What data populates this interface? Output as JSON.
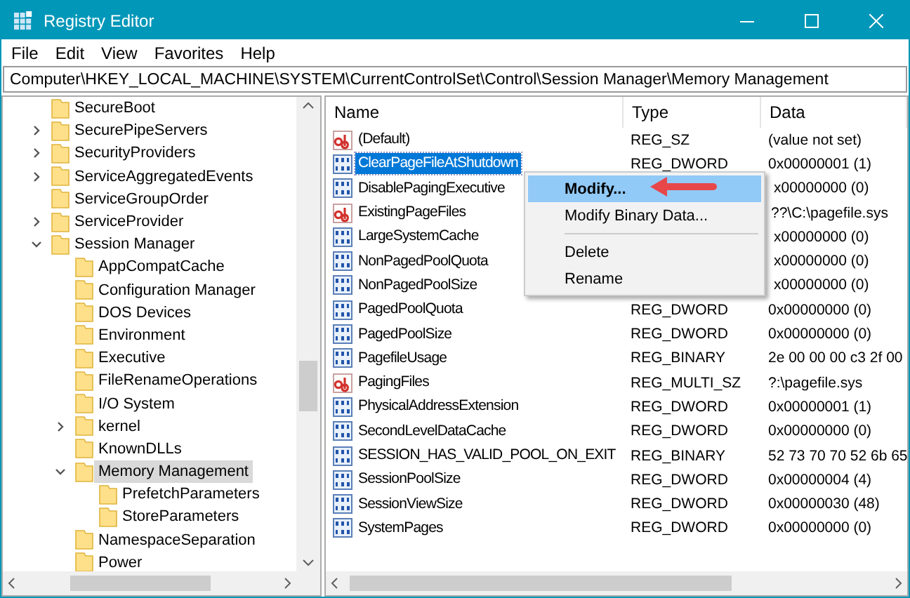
{
  "window": {
    "title": "Registry Editor"
  },
  "menu": [
    "File",
    "Edit",
    "View",
    "Favorites",
    "Help"
  ],
  "address": "Computer\\HKEY_LOCAL_MACHINE\\SYSTEM\\CurrentControlSet\\Control\\Session Manager\\Memory Management",
  "tree": [
    {
      "label": "SecureBoot",
      "selected": false
    },
    {
      "label": "SecurePipeServers",
      "expanded": false,
      "selected": false
    },
    {
      "label": "SecurityProviders",
      "expanded": false,
      "selected": false
    },
    {
      "label": "ServiceAggregatedEvents",
      "expanded": false,
      "selected": false
    },
    {
      "label": "ServiceGroupOrder",
      "selected": false
    },
    {
      "label": "ServiceProvider",
      "expanded": false,
      "selected": false
    },
    {
      "label": "Session Manager",
      "expanded": true,
      "selected": false,
      "children": [
        {
          "label": "AppCompatCache",
          "selected": false
        },
        {
          "label": "Configuration Manager",
          "selected": false
        },
        {
          "label": "DOS Devices",
          "selected": false
        },
        {
          "label": "Environment",
          "selected": false
        },
        {
          "label": "Executive",
          "selected": false
        },
        {
          "label": "FileRenameOperations",
          "selected": false
        },
        {
          "label": "I/O System",
          "selected": false
        },
        {
          "label": "kernel",
          "expanded": false,
          "selected": false
        },
        {
          "label": "KnownDLLs",
          "selected": false
        },
        {
          "label": "Memory Management",
          "expanded": true,
          "selected": true,
          "children": [
            {
              "label": "PrefetchParameters",
              "selected": false
            },
            {
              "label": "StoreParameters",
              "selected": false
            }
          ]
        },
        {
          "label": "NamespaceSeparation",
          "selected": false
        },
        {
          "label": "Power",
          "selected": false
        }
      ]
    }
  ],
  "table": {
    "columns": [
      "Name",
      "Type",
      "Data"
    ],
    "rows": [
      {
        "kind": "string",
        "name": "(Default)",
        "type": "REG_SZ",
        "data": "(value not set)",
        "selected": false
      },
      {
        "kind": "binary",
        "name": "ClearPageFileAtShutdown",
        "type": "REG_DWORD",
        "data": "0x00000001 (1)",
        "selected": true
      },
      {
        "kind": "binary",
        "name": "DisablePagingExecutive",
        "data": "x00000000 (0)",
        "selected": false
      },
      {
        "kind": "string",
        "name": "ExistingPageFiles",
        "data": "??\\C:\\pagefile.sys",
        "selected": false
      },
      {
        "kind": "binary",
        "name": "LargeSystemCache",
        "data": "x00000000 (0)",
        "selected": false
      },
      {
        "kind": "binary",
        "name": "NonPagedPoolQuota",
        "data": "x00000000 (0)",
        "selected": false
      },
      {
        "kind": "binary",
        "name": "NonPagedPoolSize",
        "data": "x00000000 (0)",
        "selected": false
      },
      {
        "kind": "binary",
        "name": "PagedPoolQuota",
        "type": "REG_DWORD",
        "data": "0x00000000 (0)",
        "selected": false
      },
      {
        "kind": "binary",
        "name": "PagedPoolSize",
        "type": "REG_DWORD",
        "data": "0x00000000 (0)",
        "selected": false
      },
      {
        "kind": "binary",
        "name": "PagefileUsage",
        "type": "REG_BINARY",
        "data": "2e 00 00 00 c3 2f 00",
        "selected": false
      },
      {
        "kind": "string",
        "name": "PagingFiles",
        "type": "REG_MULTI_SZ",
        "data": "?:\\pagefile.sys",
        "selected": false
      },
      {
        "kind": "binary",
        "name": "PhysicalAddressExtension",
        "type": "REG_DWORD",
        "data": "0x00000001 (1)",
        "selected": false
      },
      {
        "kind": "binary",
        "name": "SecondLevelDataCache",
        "type": "REG_DWORD",
        "data": "0x00000000 (0)",
        "selected": false
      },
      {
        "kind": "binary",
        "name": "SESSION_HAS_VALID_POOL_ON_EXIT",
        "type": "REG_BINARY",
        "data": "52 73 70 70 52 6b 65",
        "selected": false
      },
      {
        "kind": "binary",
        "name": "SessionPoolSize",
        "type": "REG_DWORD",
        "data": "0x00000004 (4)",
        "selected": false
      },
      {
        "kind": "binary",
        "name": "SessionViewSize",
        "type": "REG_DWORD",
        "data": "0x00000030 (48)",
        "selected": false
      },
      {
        "kind": "binary",
        "name": "SystemPages",
        "type": "REG_DWORD",
        "data": "0x00000000 (0)",
        "selected": false
      }
    ]
  },
  "context_menu": {
    "items": [
      {
        "kind": "item",
        "label": "Modify...",
        "selected": true
      },
      {
        "kind": "item",
        "label": "Modify Binary Data...",
        "selected": false
      },
      {
        "kind": "separator"
      },
      {
        "kind": "item",
        "label": "Delete",
        "selected": false
      },
      {
        "kind": "item",
        "label": "Rename",
        "selected": false
      }
    ]
  }
}
